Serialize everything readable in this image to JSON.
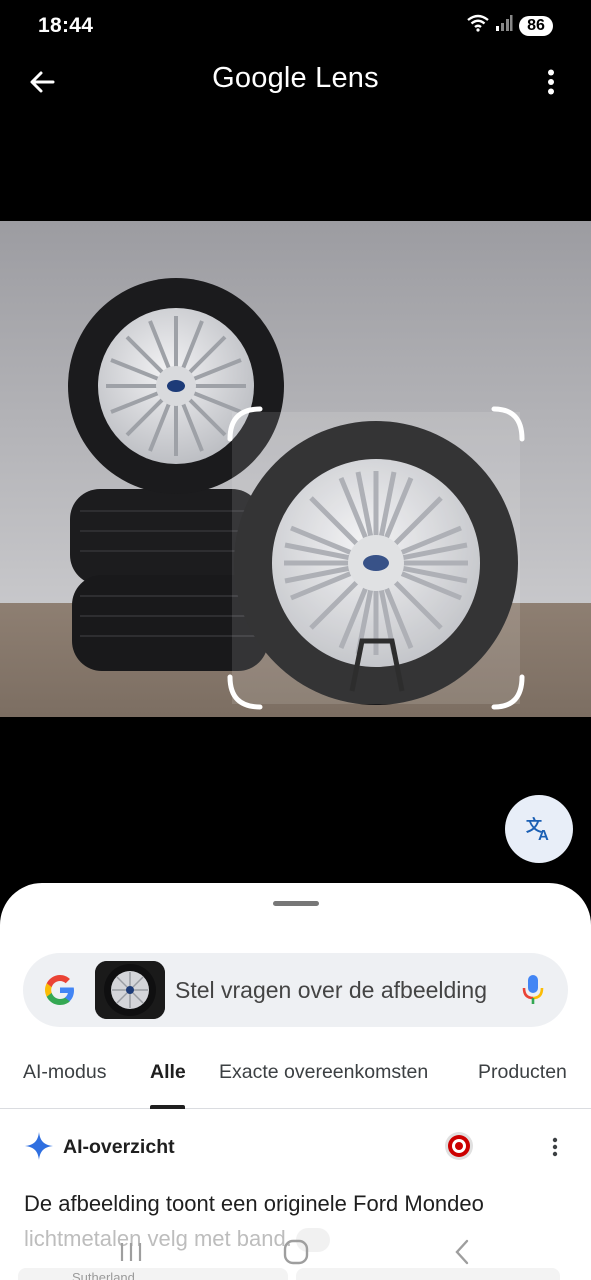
{
  "status": {
    "time": "18:44",
    "battery": "86",
    "icons": [
      "wifi-icon",
      "signal-icon"
    ]
  },
  "app": {
    "title": "Google Lens",
    "back_icon": "arrow-left-icon",
    "more_icon": "more-vert-icon"
  },
  "photo": {
    "subject": "Ford alloy wheels with tires",
    "selection_icon": "crop-corners-icon"
  },
  "translate": {
    "icon": "translate-icon"
  },
  "search": {
    "placeholder": "Stel vragen over de afbeelding",
    "logo_icon": "google-g-icon",
    "mic_icon": "mic-icon"
  },
  "tabs": [
    {
      "label": "AI-modus",
      "active": false
    },
    {
      "label": "Alle",
      "active": true
    },
    {
      "label": "Exacte overeenkomsten",
      "active": false
    },
    {
      "label": "Producten",
      "active": false
    }
  ],
  "overview": {
    "title": "AI-overzicht",
    "text_line1": "De afbeelding toont een originele Ford Mondeo",
    "text_line2": "lichtmetalen velg met band.",
    "source_label": "Sutherland"
  },
  "colors": {
    "background": "#000000",
    "sheet": "#ffffff",
    "searchbar": "#eef0f3",
    "accent_blue": "#1a73e8",
    "fab": "#e8eef8"
  }
}
